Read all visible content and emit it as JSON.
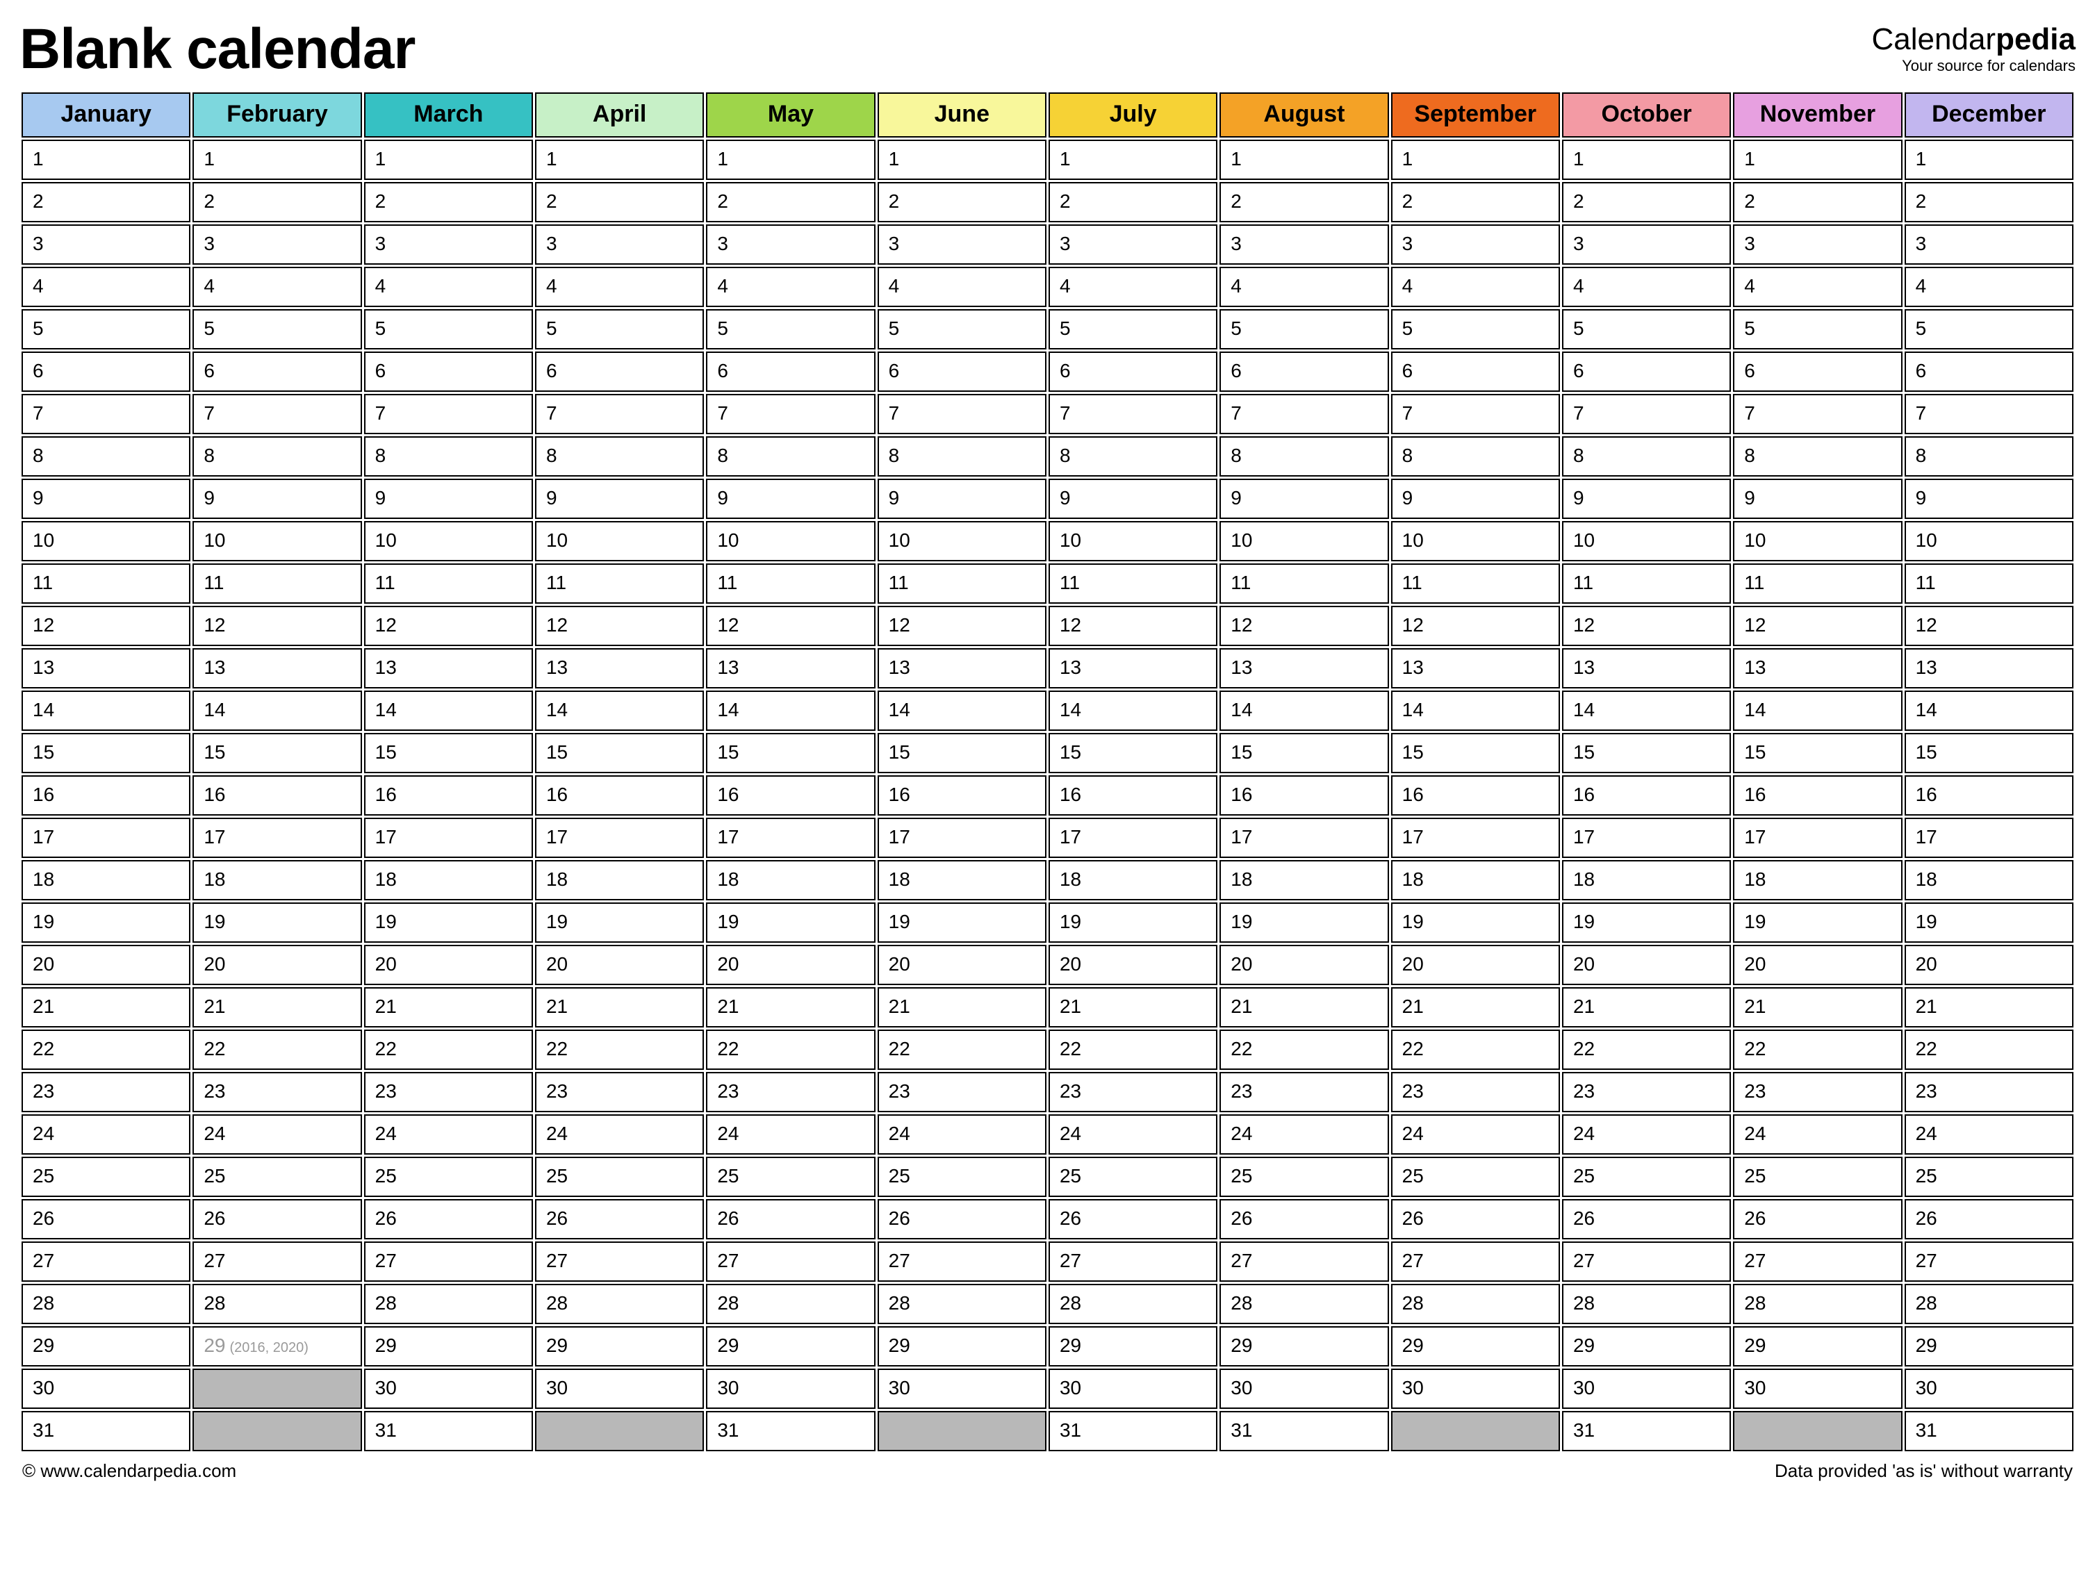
{
  "header": {
    "title": "Blank calendar",
    "brand_prefix": "Calendar",
    "brand_suffix": "pedia",
    "brand_tagline": "Your source for calendars"
  },
  "months": [
    {
      "name": "January",
      "color": "#a7c9f0",
      "days": 31
    },
    {
      "name": "February",
      "color": "#7dd7dd",
      "days": 29,
      "leap_day": 29,
      "leap_note": "(2016, 2020)"
    },
    {
      "name": "March",
      "color": "#36c1c3",
      "days": 31
    },
    {
      "name": "April",
      "color": "#c7f0c7",
      "days": 30
    },
    {
      "name": "May",
      "color": "#9ed54a",
      "days": 31
    },
    {
      "name": "June",
      "color": "#f8f79b",
      "days": 30
    },
    {
      "name": "July",
      "color": "#f6d235",
      "days": 31
    },
    {
      "name": "August",
      "color": "#f4a226",
      "days": 31
    },
    {
      "name": "September",
      "color": "#ee6b1f",
      "days": 30
    },
    {
      "name": "October",
      "color": "#f39aa4",
      "days": 31
    },
    {
      "name": "November",
      "color": "#e7a0e0",
      "days": 30
    },
    {
      "name": "December",
      "color": "#c2b6ef",
      "days": 31
    }
  ],
  "max_rows": 31,
  "footer": {
    "left": "© www.calendarpedia.com",
    "right": "Data provided 'as is' without warranty"
  }
}
